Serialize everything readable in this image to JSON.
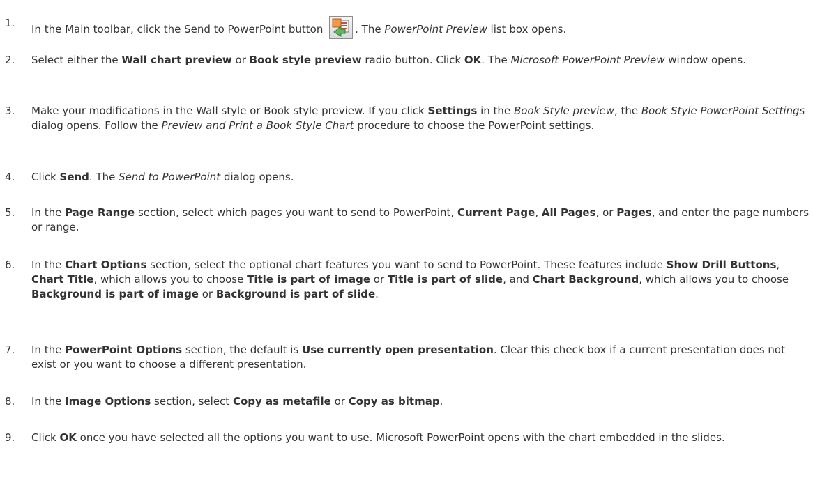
{
  "steps": [
    {
      "num": "1.",
      "parts": [
        {
          "t": "In the Main toolbar, click the Send to PowerPoint button "
        },
        {
          "icon": "send-to-powerpoint-icon"
        },
        {
          "t": ". The "
        },
        {
          "t": "PowerPoint Preview",
          "s": "i"
        },
        {
          "t": " list box opens."
        }
      ]
    },
    {
      "num": "2.",
      "parts": [
        {
          "t": "Select either the "
        },
        {
          "t": "Wall chart preview",
          "s": "b"
        },
        {
          "t": " or "
        },
        {
          "t": "Book style preview",
          "s": "b"
        },
        {
          "t": " radio button. Click "
        },
        {
          "t": "OK",
          "s": "b"
        },
        {
          "t": ". The "
        },
        {
          "t": "Microsoft PowerPoint Preview",
          "s": "i"
        },
        {
          "t": " window opens."
        }
      ]
    },
    {
      "num": "3.",
      "parts": [
        {
          "t": "Make your modifications in the Wall style or Book style preview. If you click "
        },
        {
          "t": "Settings",
          "s": "b"
        },
        {
          "t": " in the "
        },
        {
          "t": "Book Style preview",
          "s": "i"
        },
        {
          "t": ", the "
        },
        {
          "t": "Book Style PowerPoint Settings",
          "s": "i"
        },
        {
          "t": " dialog opens. Follow the "
        },
        {
          "t": "Preview and Print a Book Style Chart",
          "s": "i"
        },
        {
          "t": " procedure to choose the PowerPoint settings."
        }
      ]
    },
    {
      "num": "4.",
      "parts": [
        {
          "t": "Click "
        },
        {
          "t": "Send",
          "s": "b"
        },
        {
          "t": ". The "
        },
        {
          "t": "Send to PowerPoint",
          "s": "i"
        },
        {
          "t": " dialog opens."
        }
      ]
    },
    {
      "num": "5.",
      "parts": [
        {
          "t": "In the "
        },
        {
          "t": "Page Range",
          "s": "b"
        },
        {
          "t": " section, select which pages you want to send to PowerPoint, "
        },
        {
          "t": "Current Page",
          "s": "b"
        },
        {
          "t": ", "
        },
        {
          "t": "All Pages",
          "s": "b"
        },
        {
          "t": ", or "
        },
        {
          "t": "Pages",
          "s": "b"
        },
        {
          "t": ", and enter the page numbers or range."
        }
      ]
    },
    {
      "num": "6.",
      "parts": [
        {
          "t": "In the "
        },
        {
          "t": "Chart Options",
          "s": "b"
        },
        {
          "t": " section, select the optional chart features you want to send to PowerPoint. These features include "
        },
        {
          "t": "Show Drill Buttons",
          "s": "b"
        },
        {
          "t": ", "
        },
        {
          "t": "Chart Title",
          "s": "b"
        },
        {
          "t": ", which allows you to choose "
        },
        {
          "t": "Title is part of image",
          "s": "b"
        },
        {
          "t": " or "
        },
        {
          "t": "Title is part of slide",
          "s": "b"
        },
        {
          "t": ", and "
        },
        {
          "t": "Chart Background",
          "s": "b"
        },
        {
          "t": ", which allows you to choose "
        },
        {
          "t": "Background is part of image",
          "s": "b"
        },
        {
          "t": " or "
        },
        {
          "t": "Background is part of slide",
          "s": "b"
        },
        {
          "t": "."
        }
      ]
    },
    {
      "num": "7.",
      "parts": [
        {
          "t": "In the "
        },
        {
          "t": "PowerPoint Options",
          "s": "b"
        },
        {
          "t": " section, the default is "
        },
        {
          "t": "Use currently open presentation",
          "s": "b"
        },
        {
          "t": ". Clear this check box if a current presentation does not exist or you want to choose a different presentation."
        }
      ]
    },
    {
      "num": "8.",
      "parts": [
        {
          "t": "In the "
        },
        {
          "t": "Image Options",
          "s": "b"
        },
        {
          "t": " section, select "
        },
        {
          "t": "Copy as metafile",
          "s": "b"
        },
        {
          "t": " or "
        },
        {
          "t": "Copy as bitmap",
          "s": "b"
        },
        {
          "t": "."
        }
      ]
    },
    {
      "num": "9.",
      "parts": [
        {
          "t": "Click "
        },
        {
          "t": "OK",
          "s": "b"
        },
        {
          "t": " once you have selected all the options you want to use. Microsoft PowerPoint opens with the chart embedded in the slides."
        }
      ]
    }
  ]
}
